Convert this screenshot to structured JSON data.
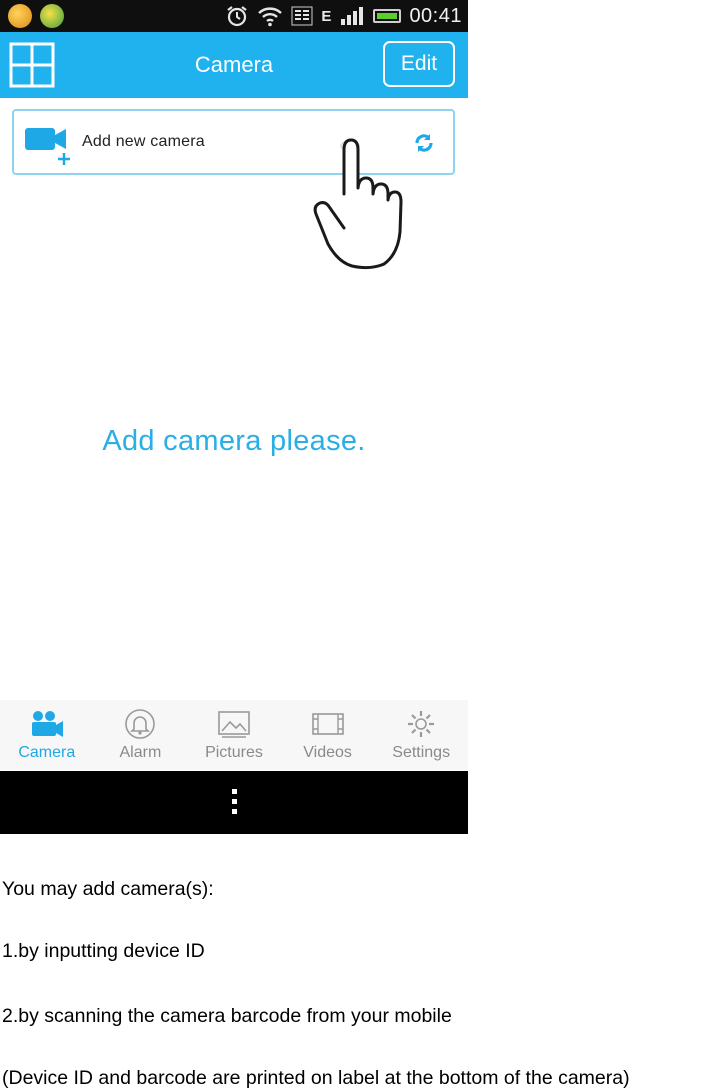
{
  "status_bar": {
    "time": "00:41",
    "network_type": "E",
    "icons": [
      "app-icon-1",
      "app-icon-2",
      "alarm-clock-icon",
      "wifi-icon",
      "data-3g-icon",
      "signal-icon",
      "battery-icon"
    ]
  },
  "nav_bar": {
    "title": "Camera",
    "edit_label": "Edit",
    "left_icon": "grid-icon",
    "background": "#1fb2ef"
  },
  "add_camera": {
    "label": "Add new camera",
    "icon": "add-camera-icon",
    "action_icon": "refresh-icon"
  },
  "empty_message": "Add camera please.",
  "tab_bar": {
    "tabs": [
      {
        "label": "Camera",
        "icon": "camera-tab-icon",
        "active": true
      },
      {
        "label": "Alarm",
        "icon": "bell-icon",
        "active": false
      },
      {
        "label": "Pictures",
        "icon": "pictures-icon",
        "active": false
      },
      {
        "label": "Videos",
        "icon": "film-icon",
        "active": false
      },
      {
        "label": "Settings",
        "icon": "gear-icon",
        "active": false
      }
    ]
  },
  "system_bar": {
    "icon": "overflow-menu-icon"
  },
  "instructions": {
    "intro": "You may add camera(s):",
    "step1": "1.by inputting device ID",
    "step2": "2.by scanning the camera barcode from your mobile",
    "note": "(Device ID and barcode are printed on label at the bottom of the camera)"
  },
  "colors": {
    "accent": "#1fb2ef",
    "active_tab": "#1fa8e6",
    "inactive_tab": "#8a8a8a"
  }
}
